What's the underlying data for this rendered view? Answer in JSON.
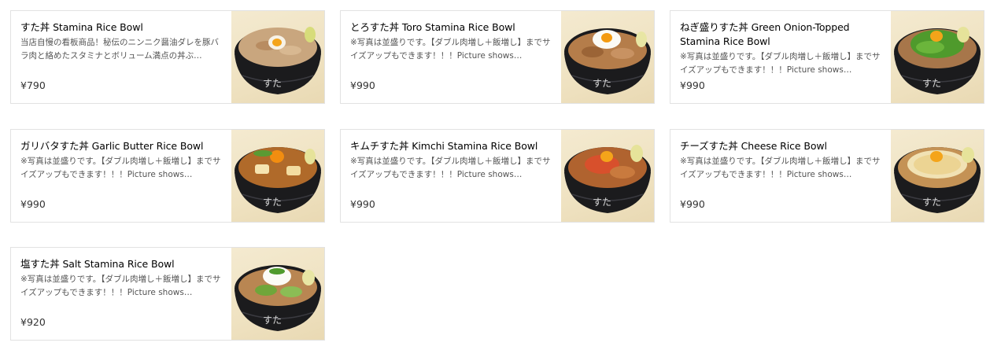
{
  "menu_items": [
    {
      "title": "すた丼 Stamina Rice Bowl",
      "description": "当店自慢の看板商品！秘伝のニンニク醤油ダレを豚バラ肉と絡めたスタミナとボリューム満点の丼ぶ…",
      "price": "¥790",
      "image": "stamina-rice-bowl-photo"
    },
    {
      "title": "とろすた丼 Toro Stamina Rice Bowl",
      "description": "※写真は並盛りです。【ダブル肉増し＋飯増し】までサイズアップもできます！！！Picture shows…",
      "price": "¥990",
      "image": "toro-stamina-rice-bowl-photo"
    },
    {
      "title": "ねぎ盛りすた丼 Green Onion-Topped Stamina Rice Bowl",
      "description": "※写真は並盛りです。【ダブル肉増し＋飯増し】までサイズアップもできます！！！Picture shows…",
      "price": "¥990",
      "image": "green-onion-stamina-rice-bowl-photo"
    },
    {
      "title": "ガリバタすた丼 Garlic Butter Rice Bowl",
      "description": "※写真は並盛りです。【ダブル肉増し＋飯増し】までサイズアップもできます！！！Picture shows…",
      "price": "¥990",
      "image": "garlic-butter-rice-bowl-photo"
    },
    {
      "title": "キムチすた丼 Kimchi Stamina Rice Bowl",
      "description": "※写真は並盛りです。【ダブル肉増し＋飯増し】までサイズアップもできます！！！Picture shows…",
      "price": "¥990",
      "image": "kimchi-stamina-rice-bowl-photo"
    },
    {
      "title": "チーズすた丼 Cheese Rice Bowl",
      "description": "※写真は並盛りです。【ダブル肉増し＋飯増し】までサイズアップもできます！！！Picture shows…",
      "price": "¥990",
      "image": "cheese-rice-bowl-photo"
    },
    {
      "title": "塩すた丼 Salt Stamina Rice Bowl",
      "description": "※写真は並盛りです。【ダブル肉増し＋飯増し】までサイズアップもできます！！！Picture shows…",
      "price": "¥920",
      "image": "salt-stamina-rice-bowl-photo"
    }
  ],
  "colors": {
    "card_border": "#e2e2e2",
    "description_text": "#545454",
    "price_text": "#333333",
    "photo_background": "#f1e6c8",
    "bowl": "#1c1c1e"
  }
}
